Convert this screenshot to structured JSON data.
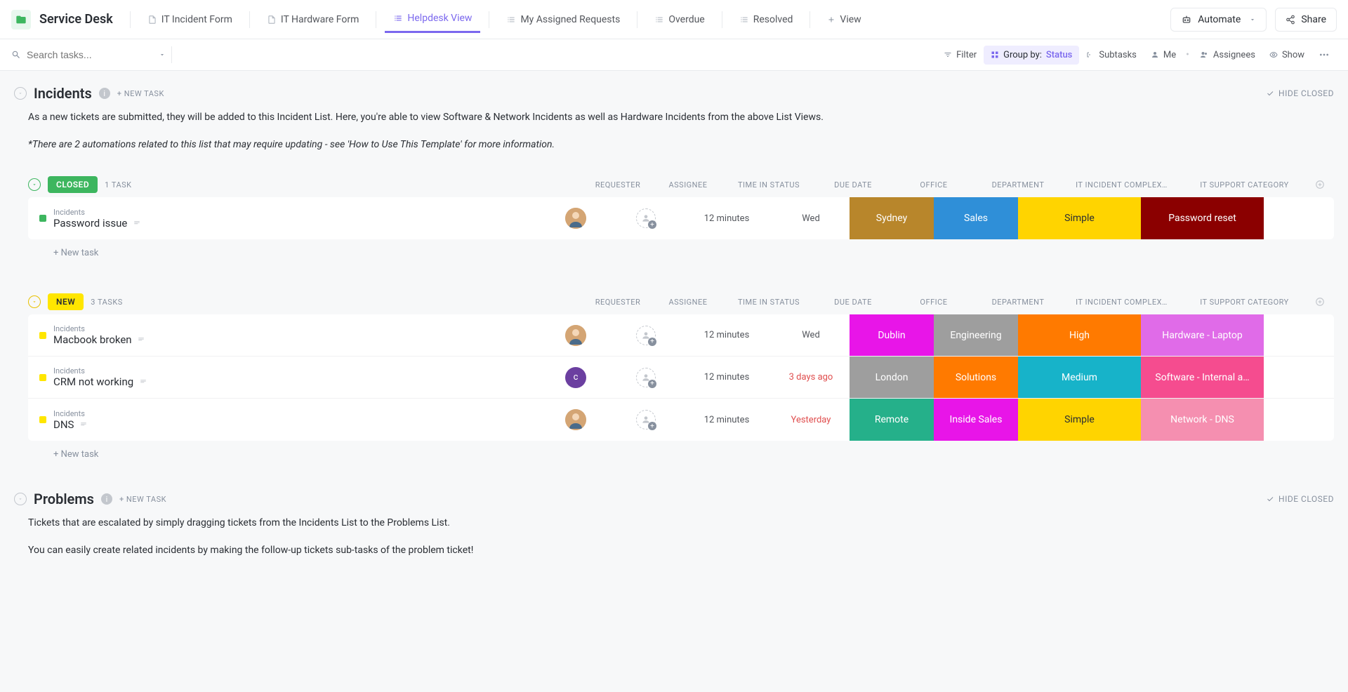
{
  "header": {
    "project_title": "Service Desk",
    "tabs": [
      {
        "label": "IT Incident Form",
        "active": false,
        "type": "form"
      },
      {
        "label": "IT Hardware Form",
        "active": false,
        "type": "form"
      },
      {
        "label": "Helpdesk View",
        "active": true,
        "type": "list"
      },
      {
        "label": "My Assigned Requests",
        "active": false,
        "type": "list"
      },
      {
        "label": "Overdue",
        "active": false,
        "type": "list"
      },
      {
        "label": "Resolved",
        "active": false,
        "type": "list"
      }
    ],
    "add_view": "View",
    "automate": "Automate",
    "share": "Share"
  },
  "toolbar": {
    "search_placeholder": "Search tasks...",
    "filter": "Filter",
    "group_by_label": "Group by:",
    "group_by_value": "Status",
    "subtasks": "Subtasks",
    "me": "Me",
    "assignees": "Assignees",
    "show": "Show"
  },
  "sections": {
    "incidents": {
      "title": "Incidents",
      "new_task_label": "+ NEW TASK",
      "hide_closed": "HIDE CLOSED",
      "description": "As a new tickets are submitted, they will be added to this Incident List. Here, you're able to view Software & Network Incidents as well as Hardware Incidents from the above List Views.",
      "note": "*There are 2 automations related to this list that may require updating - see 'How to Use This Template' for more information."
    },
    "problems": {
      "title": "Problems",
      "new_task_label": "+ NEW TASK",
      "hide_closed": "HIDE CLOSED",
      "description": "Tickets that are escalated by simply dragging tickets from the Incidents List to the Problems List.",
      "description2": "You can easily create related incidents by making the follow-up tickets sub-tasks of the problem ticket!"
    }
  },
  "columns": {
    "requester": "REQUESTER",
    "assignee": "ASSIGNEE",
    "time_in_status": "TIME IN STATUS",
    "due_date": "DUE DATE",
    "office": "OFFICE",
    "department": "DEPARTMENT",
    "complexity": "IT INCIDENT COMPLEX…",
    "support_category": "IT SUPPORT CATEGORY"
  },
  "groups": [
    {
      "status": "CLOSED",
      "status_class": "closed",
      "count_label": "1 TASK",
      "rows": [
        {
          "parent": "Incidents",
          "name": "Password issue",
          "requester": {
            "type": "photo"
          },
          "time": "12 minutes",
          "due": "Wed",
          "due_overdue": false,
          "office": {
            "label": "Sydney",
            "color": "#b8862b"
          },
          "department": {
            "label": "Sales",
            "color": "#2f8fd8"
          },
          "complexity": {
            "label": "Simple",
            "color": "#ffd400",
            "text": "#2a2e34"
          },
          "category": {
            "label": "Password reset",
            "color": "#8b0000"
          }
        }
      ],
      "new_task": "+ New task"
    },
    {
      "status": "NEW",
      "status_class": "new",
      "count_label": "3 TASKS",
      "rows": [
        {
          "parent": "Incidents",
          "name": "Macbook broken",
          "requester": {
            "type": "photo"
          },
          "time": "12 minutes",
          "due": "Wed",
          "due_overdue": false,
          "office": {
            "label": "Dublin",
            "color": "#e815e8"
          },
          "department": {
            "label": "Engineering",
            "color": "#9e9e9e"
          },
          "complexity": {
            "label": "High",
            "color": "#ff7a00"
          },
          "category": {
            "label": "Hardware - Laptop",
            "color": "#e06be8"
          }
        },
        {
          "parent": "Incidents",
          "name": "CRM not working",
          "requester": {
            "type": "letter",
            "letter": "c"
          },
          "time": "12 minutes",
          "due": "3 days ago",
          "due_overdue": true,
          "office": {
            "label": "London",
            "color": "#9e9e9e"
          },
          "department": {
            "label": "Solutions",
            "color": "#ff7a00"
          },
          "complexity": {
            "label": "Medium",
            "color": "#17b3c9"
          },
          "category": {
            "label": "Software - Internal a…",
            "color": "#f54c8f"
          }
        },
        {
          "parent": "Incidents",
          "name": "DNS",
          "requester": {
            "type": "photo"
          },
          "time": "12 minutes",
          "due": "Yesterday",
          "due_overdue": true,
          "office": {
            "label": "Remote",
            "color": "#25b08a"
          },
          "department": {
            "label": "Inside Sales",
            "color": "#e815e8"
          },
          "complexity": {
            "label": "Simple",
            "color": "#ffd400",
            "text": "#2a2e34"
          },
          "category": {
            "label": "Network - DNS",
            "color": "#f58fb0"
          }
        }
      ],
      "new_task": "+ New task"
    }
  ]
}
